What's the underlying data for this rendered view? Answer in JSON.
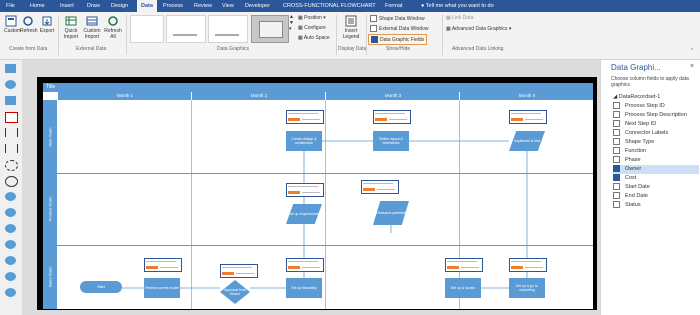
{
  "tabs": [
    "File",
    "Home",
    "Insert",
    "Draw",
    "Design",
    "Data",
    "Process",
    "Review",
    "View",
    "Developer",
    "CROSS-FUNCTIONAL FLOWCHART",
    "Format"
  ],
  "tell_me": "Tell me what you want to do",
  "ribbon": {
    "create_from_data": {
      "label": "Create from Data",
      "buttons": [
        "Custom",
        "Refresh",
        "Export"
      ]
    },
    "external_data": {
      "label": "External Data",
      "buttons": [
        "Quick Import",
        "Custom Import",
        "Refresh All"
      ]
    },
    "data_graphics": {
      "label": "Data Graphics",
      "options": [
        "Position",
        "Configure",
        "Auto Space"
      ]
    },
    "display_data": {
      "label": "Display Data",
      "insert_legend": "Insert Legend"
    },
    "show_hide": {
      "label": "Show/Hide",
      "items": [
        {
          "label": "Shape Data Window",
          "checked": false
        },
        {
          "label": "External Data Window",
          "checked": false
        },
        {
          "label": "Data Graphic Fields",
          "checked": true
        }
      ]
    },
    "advanced_linking": {
      "label": "Advanced Data Linking",
      "items": [
        "Link Data",
        "Advanced Data Graphics"
      ]
    }
  },
  "diagram": {
    "title": "Title",
    "months": [
      "Month 1",
      "Month 2",
      "Month 3",
      "Month 4"
    ],
    "lanes": [
      "Web Team",
      "Product Team",
      "Sales Team"
    ],
    "shapes": {
      "start": "Start",
      "p1": "Create design & architecture",
      "p2": "Refine layout & wireframes",
      "p3": "Implement & test",
      "p4": "Set up requirements",
      "p5": "Research potential",
      "p6": "Review current model",
      "p7": "Approval from Board",
      "p8": "Set up feasibility",
      "p9": "Set up & launch",
      "p10": "Set up & go to marketing"
    }
  },
  "task_pane": {
    "title": "Data Graphi...",
    "close": "×",
    "description": "Choose column fields to apply data graphics.",
    "group": "DataRecordset-1",
    "fields": [
      {
        "label": "Process Step ID",
        "checked": false,
        "selected": false
      },
      {
        "label": "Process Step Description",
        "checked": false,
        "selected": false
      },
      {
        "label": "Next Step ID",
        "checked": false,
        "selected": false
      },
      {
        "label": "Connector Labels",
        "checked": false,
        "selected": false
      },
      {
        "label": "Shape Type",
        "checked": false,
        "selected": false
      },
      {
        "label": "Function",
        "checked": false,
        "selected": false
      },
      {
        "label": "Phase",
        "checked": false,
        "selected": false
      },
      {
        "label": "Owner",
        "checked": true,
        "selected": true
      },
      {
        "label": "Cost",
        "checked": true,
        "selected": false
      },
      {
        "label": "Start Date",
        "checked": false,
        "selected": false
      },
      {
        "label": "End Date",
        "checked": false,
        "selected": false
      },
      {
        "label": "Status",
        "checked": false,
        "selected": false
      }
    ]
  },
  "colors": {
    "ribbon_blue": "#2b579a",
    "swimlane_blue": "#5b9bd5",
    "accent_orange": "#ed7d31"
  }
}
